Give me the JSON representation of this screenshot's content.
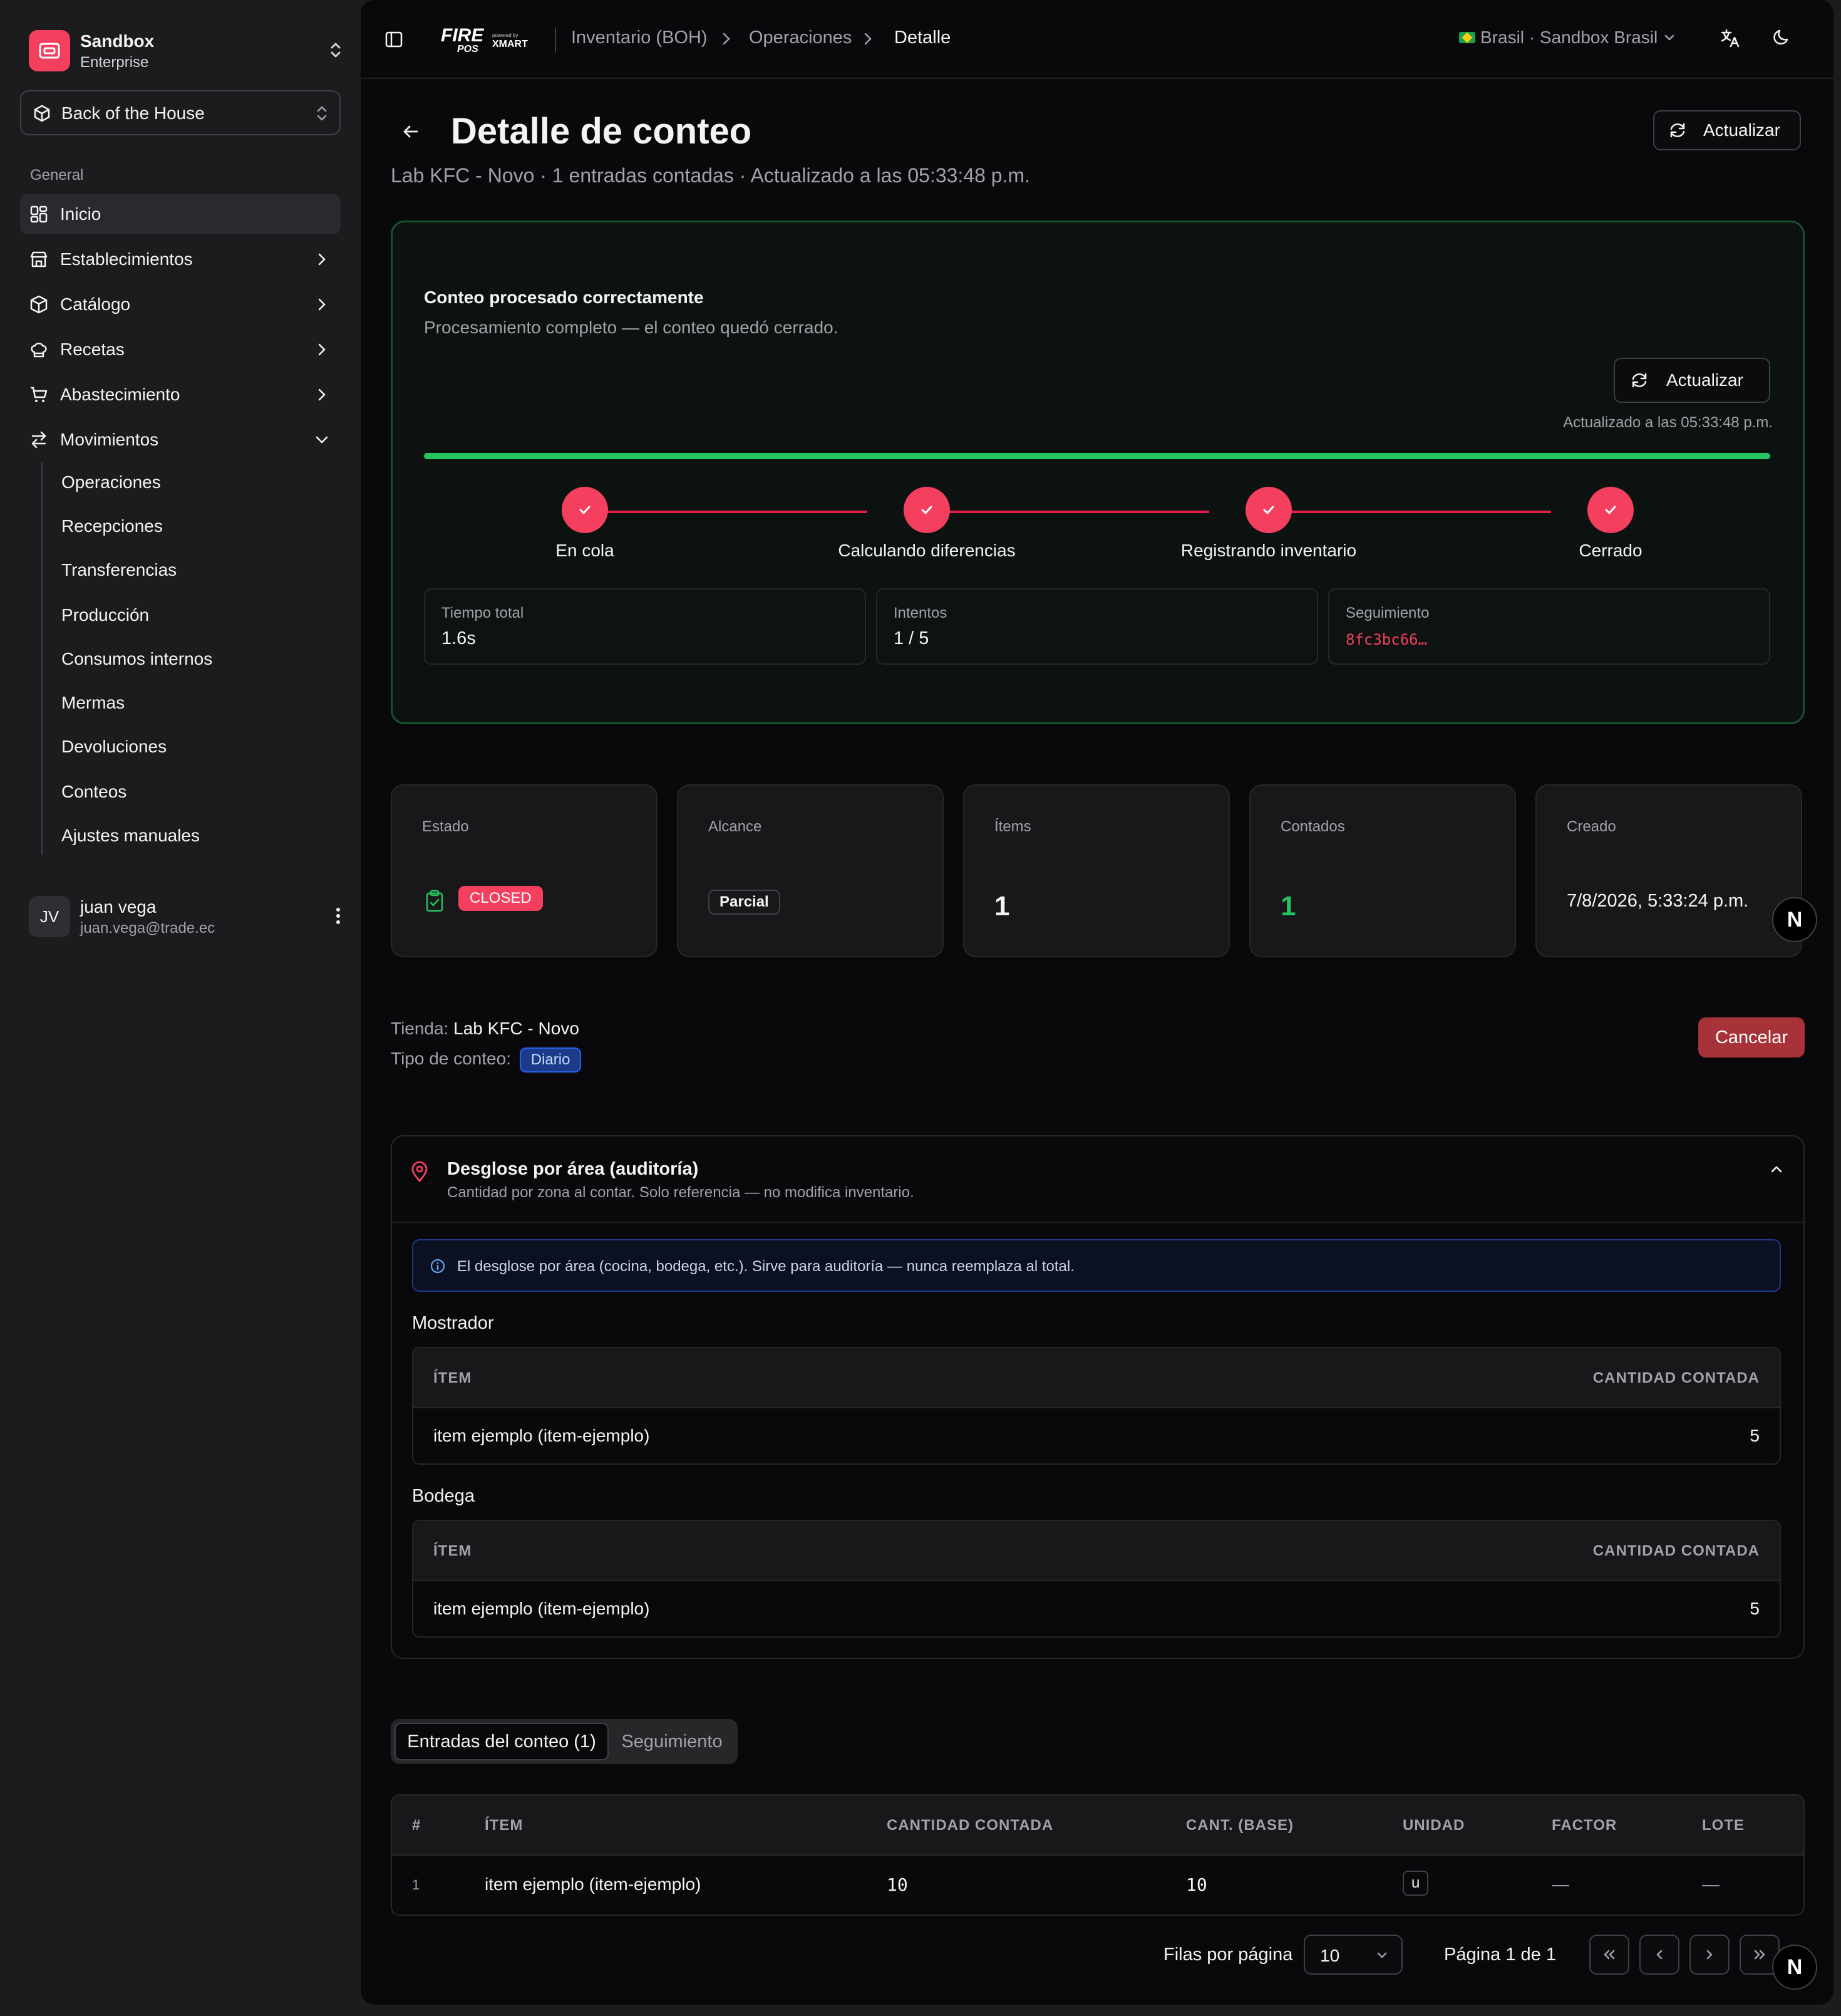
{
  "sidebar": {
    "workspace_name": "Sandbox",
    "workspace_plan": "Enterprise",
    "business_unit": "Back of the House",
    "section_label": "General",
    "nav": {
      "inicio": "Inicio",
      "establecimientos": "Establecimientos",
      "catalogo": "Catálogo",
      "recetas": "Recetas",
      "abastecimiento": "Abastecimiento",
      "movimientos": "Movimientos"
    },
    "sub": {
      "operaciones": "Operaciones",
      "recepciones": "Recepciones",
      "transferencias": "Transferencias",
      "produccion": "Producción",
      "consumos": "Consumos internos",
      "mermas": "Mermas",
      "devoluciones": "Devoluciones",
      "conteos": "Conteos",
      "ajustes": "Ajustes manuales"
    },
    "user": {
      "initials": "JV",
      "name": "juan vega",
      "email": "juan.vega@trade.ec"
    }
  },
  "topbar": {
    "logo_main": "FIRE",
    "logo_sub": "POS",
    "logo_powered": "powered by",
    "logo_brand": "XMART",
    "breadcrumb": [
      "Inventario (BOH)",
      "Operaciones",
      "Detalle"
    ],
    "region": "Brasil · Sandbox Brasil"
  },
  "header": {
    "title": "Detalle de conteo",
    "subtitle": "Lab KFC - Novo · 1 entradas contadas · Actualizado a las 05:33:48 p.m.",
    "refresh_label": "Actualizar"
  },
  "status": {
    "title": "Conteo procesado correctamente",
    "description": "Procesamiento completo — el conteo quedó cerrado.",
    "refresh_label": "Actualizar",
    "updated": "Actualizado a las 05:33:48 p.m.",
    "progress": 1.0,
    "steps": [
      "En cola",
      "Calculando diferencias",
      "Registrando inventario",
      "Cerrado"
    ],
    "metrics": {
      "tiempo_k": "Tiempo total",
      "tiempo_v": "1.6s",
      "intentos_k": "Intentos",
      "intentos_v": "1 / 5",
      "seguimiento_k": "Seguimiento",
      "seguimiento_v": "8fc3bc66…"
    }
  },
  "kpis": {
    "estado_k": "Estado",
    "estado_v": "CLOSED",
    "alcance_k": "Alcance",
    "alcance_v": "Parcial",
    "items_k": "Ítems",
    "items_v": "1",
    "contados_k": "Contados",
    "contados_v": "1",
    "creado_k": "Creado",
    "creado_v": "7/8/2026, 5:33:24 p.m."
  },
  "fab_letter": "N",
  "info": {
    "tienda_label": "Tienda:",
    "tienda_value": "Lab KFC - Novo",
    "tipo_label": "Tipo de conteo:",
    "tipo_value": "Diario",
    "cancel_label": "Cancelar"
  },
  "area": {
    "title": "Desglose por área (auditoría)",
    "subtitle": "Cantidad por zona al contar. Solo referencia — no modifica inventario.",
    "alert": "El desglose por área (cocina, bodega, etc.). Sirve para auditoría — nunca reemplaza al total.",
    "col_item": "ÍTEM",
    "col_qty": "CANTIDAD CONTADA",
    "groups": [
      {
        "name": "Mostrador",
        "rows": [
          {
            "item": "item ejemplo (item-ejemplo)",
            "qty": "5"
          }
        ]
      },
      {
        "name": "Bodega",
        "rows": [
          {
            "item": "item ejemplo (item-ejemplo)",
            "qty": "5"
          }
        ]
      }
    ]
  },
  "tabs": {
    "entries": "Entradas del conteo (1)",
    "tracking": "Seguimiento"
  },
  "entries": {
    "columns": {
      "num": "#",
      "item": "ÍTEM",
      "counted": "CANTIDAD CONTADA",
      "base": "CANT. (BASE)",
      "unit": "UNIDAD",
      "factor": "FACTOR",
      "lot": "LOTE"
    },
    "rows": [
      {
        "num": "1",
        "item": "item ejemplo (item-ejemplo)",
        "counted": "10",
        "base": "10",
        "unit": "u",
        "factor": "—",
        "lot": "—"
      }
    ]
  },
  "pagination": {
    "rows_label": "Filas por página",
    "rows_value": "10",
    "page_label": "Página 1 de 1"
  }
}
